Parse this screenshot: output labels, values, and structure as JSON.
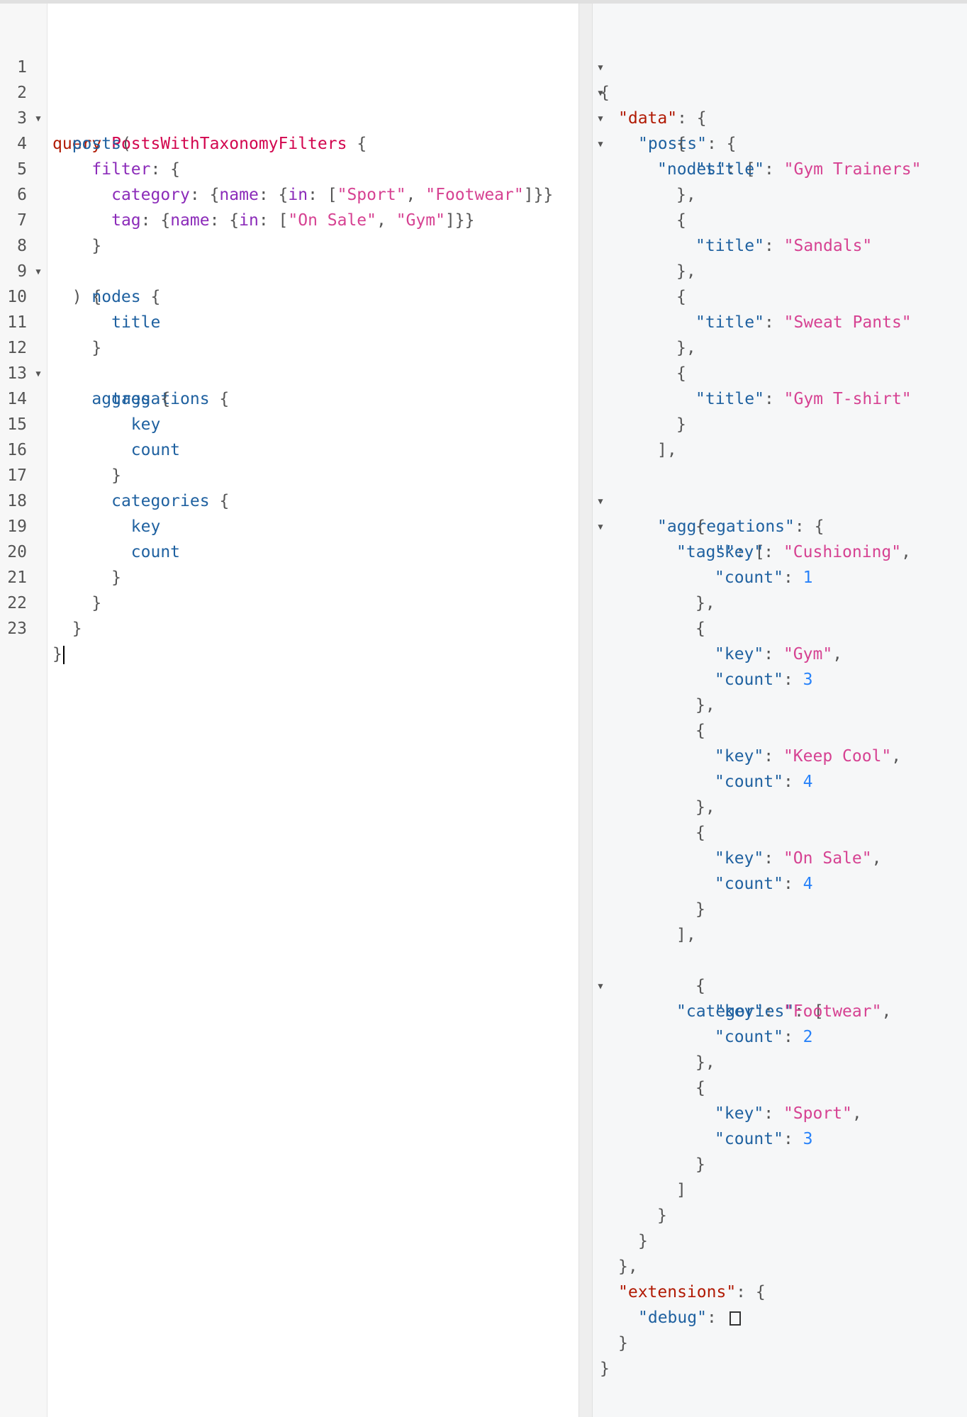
{
  "query_editor": {
    "line_numbers": [
      "1",
      "2",
      "3",
      "4",
      "5",
      "6",
      "7",
      "8",
      "9",
      "10",
      "11",
      "12",
      "13",
      "14",
      "15",
      "16",
      "17",
      "18",
      "19",
      "20",
      "21",
      "22",
      "23"
    ],
    "keyword": "query",
    "operation_name": "PostsWithTaxonomyFilters",
    "field_posts": "posts",
    "arg_filter": "filter",
    "arg_category": "category",
    "arg_name": "name",
    "arg_in": "in",
    "category_values": [
      "\"Sport\"",
      "\"Footwear\""
    ],
    "arg_tag": "tag",
    "tag_values": [
      "\"On Sale\"",
      "\"Gym\""
    ],
    "field_nodes": "nodes",
    "field_title": "title",
    "field_aggregations": "aggregations",
    "field_tags": "tags",
    "field_key": "key",
    "field_count": "count",
    "field_categories": "categories"
  },
  "result_viewer": {
    "data_key": "\"data\"",
    "posts_key": "\"posts\"",
    "nodes_key": "\"nodes\"",
    "title_key": "\"title\"",
    "titles": [
      "\"Gym Trainers\"",
      "\"Sandals\"",
      "\"Sweat Pants\"",
      "\"Gym T-shirt\""
    ],
    "aggregations_key": "\"aggregations\"",
    "tags_key": "\"tags\"",
    "key_key": "\"key\"",
    "count_key": "\"count\"",
    "tags": [
      {
        "key": "\"Cushioning\"",
        "count": "1"
      },
      {
        "key": "\"Gym\"",
        "count": "3"
      },
      {
        "key": "\"Keep Cool\"",
        "count": "4"
      },
      {
        "key": "\"On Sale\"",
        "count": "4"
      }
    ],
    "categories_key": "\"categories\"",
    "categories": [
      {
        "key": "\"Footwear\"",
        "count": "2"
      },
      {
        "key": "\"Sport\"",
        "count": "3"
      }
    ],
    "extensions_key": "\"extensions\"",
    "debug_key": "\"debug\""
  },
  "icons": {
    "fold": "triangle-down-icon",
    "empty_array": "empty-array-icon"
  }
}
